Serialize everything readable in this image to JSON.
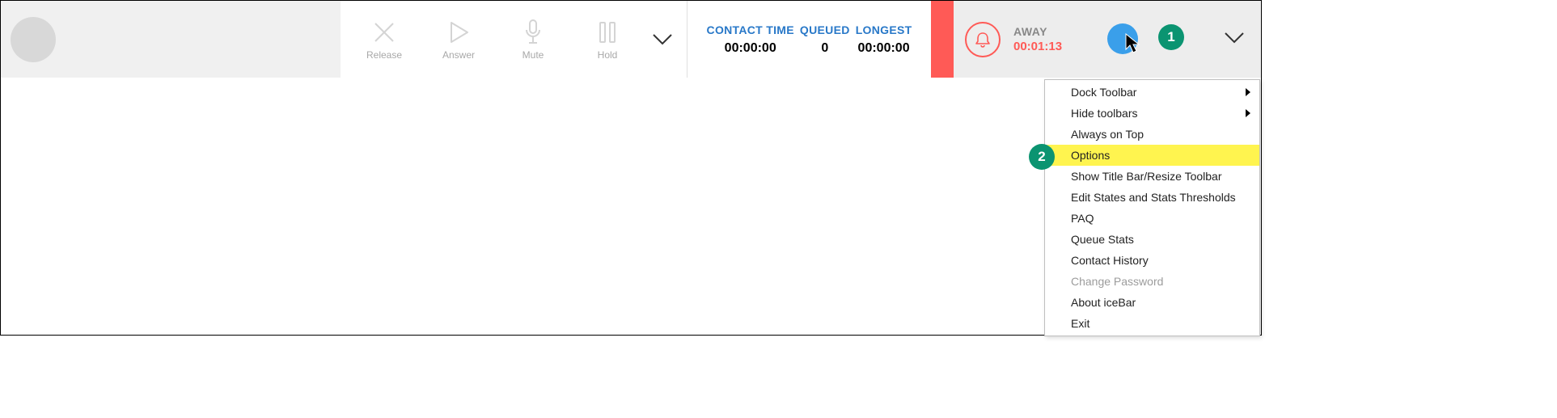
{
  "actions": {
    "release": "Release",
    "answer": "Answer",
    "mute": "Mute",
    "hold": "Hold"
  },
  "stats": {
    "contact_time": {
      "label": "CONTACT TIME",
      "value": "00:00:00"
    },
    "queued": {
      "label": "QUEUED",
      "value": "0"
    },
    "longest": {
      "label": "LONGEST",
      "value": "00:00:00"
    }
  },
  "status": {
    "label": "AWAY",
    "time": "00:01:13"
  },
  "menu": {
    "items": [
      {
        "label": "Dock Toolbar",
        "submenu": true
      },
      {
        "label": "Hide toolbars",
        "submenu": true
      },
      {
        "label": "Always on Top"
      },
      {
        "label": "Options",
        "highlighted": true
      },
      {
        "label": "Show Title Bar/Resize Toolbar"
      },
      {
        "label": "Edit States and Stats Thresholds"
      },
      {
        "label": "PAQ"
      },
      {
        "label": "Queue Stats"
      },
      {
        "label": "Contact History"
      },
      {
        "label": "Change Password",
        "disabled": true
      },
      {
        "label": "About iceBar"
      },
      {
        "label": "Exit"
      }
    ]
  },
  "annotations": {
    "badge1": "1",
    "badge2": "2"
  }
}
